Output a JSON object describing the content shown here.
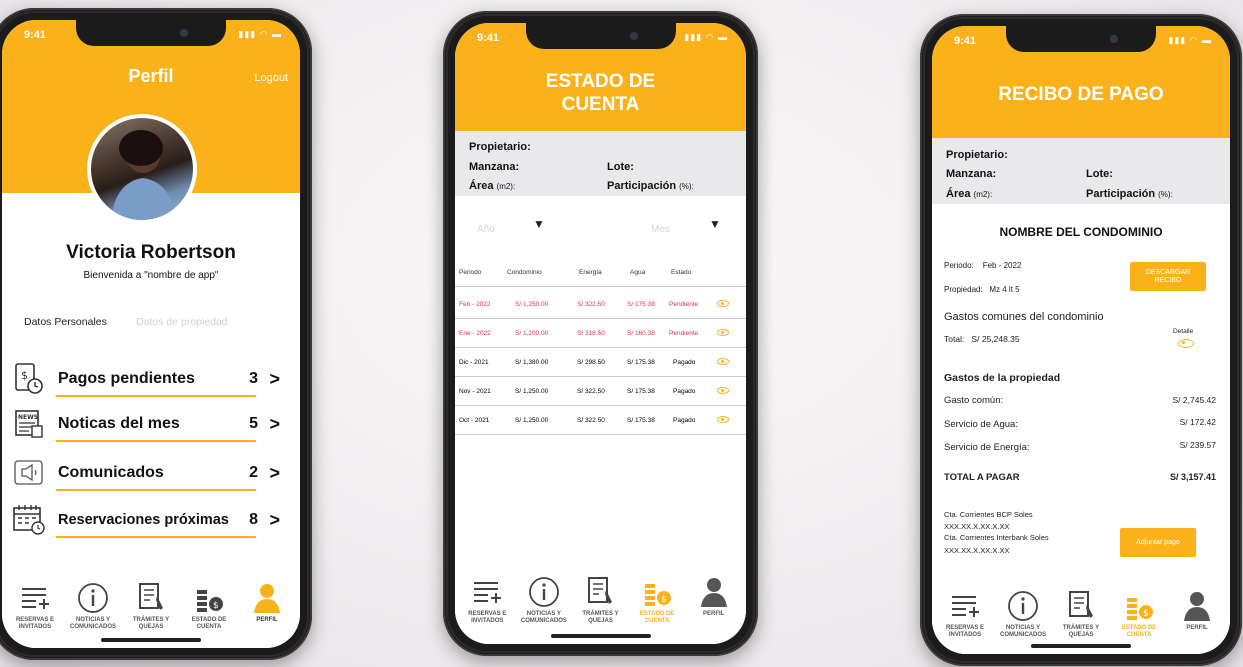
{
  "status": {
    "time": "9:41"
  },
  "perfil": {
    "title": "Perfil",
    "logout": "Logout",
    "name": "Victoria Robertson",
    "welcome": "Bienvenida a \"nombre de app\"",
    "tab_personal": "Datos Personales",
    "tab_property": "Datos de propiedad",
    "menu": [
      {
        "label": "Pagos pendientes",
        "count": "3",
        "icon": "receipt-icon"
      },
      {
        "label": "Noticas del mes",
        "count": "5",
        "icon": "news-icon"
      },
      {
        "label": "Comunicados",
        "count": "2",
        "icon": "megaphone-icon"
      },
      {
        "label": "Reservaciones próximas",
        "count": "8",
        "icon": "calendar-icon"
      }
    ]
  },
  "tabbar": {
    "reservas": "RESERVAS E INVITADOS",
    "noticias": "NOTICIAS Y COMUNICADOS",
    "tramites": "TRÁMITES Y QUEJAS",
    "estado": "ESTADO DE CUENTA",
    "perfil": "PERFIL"
  },
  "estado": {
    "title_line1": "ESTADO DE",
    "title_line2": "CUENTA",
    "propietario": "Propietario:",
    "manzana": "Manzana:",
    "lote": "Lote:",
    "area": "Área",
    "area_unit": "(m2):",
    "participacion": "Participación",
    "participacion_unit": "(%):",
    "year_placeholder": "Año",
    "month_placeholder": "Mes",
    "headers": [
      "Periodo",
      "Condominio",
      "Energía",
      "Agua",
      "Estado"
    ],
    "rows": [
      {
        "periodo": "Feb - 2022",
        "condominio": "S/ 1,250.00",
        "energia": "S/ 322.50",
        "agua": "S/ 175.38",
        "estado": "Pendiente",
        "pending": true
      },
      {
        "periodo": "Ene - 2022",
        "condominio": "S/ 1,200.00",
        "energia": "S/ 318.50",
        "agua": "S/ 160.38",
        "estado": "Pendiente",
        "pending": true
      },
      {
        "periodo": "Dic - 2021",
        "condominio": "S/ 1,380.00",
        "energia": "S/ 298.50",
        "agua": "S/ 175.38",
        "estado": "Pagado",
        "pending": false
      },
      {
        "periodo": "Nov - 2021",
        "condominio": "S/ 1,250.00",
        "energia": "S/ 322.50",
        "agua": "S/ 175.38",
        "estado": "Pagado",
        "pending": false
      },
      {
        "periodo": "Oct - 2021",
        "condominio": "S/ 1,250.00",
        "energia": "S/ 322.50",
        "agua": "S/ 175.38",
        "estado": "Pagado",
        "pending": false
      }
    ]
  },
  "recibo": {
    "title": "RECIBO DE PAGO",
    "propietario": "Propietario:",
    "manzana": "Manzana:",
    "lote": "Lote:",
    "area": "Área",
    "area_unit": "(m2):",
    "participacion": "Participación",
    "participacion_unit": "(%):",
    "condominio": "NOMBRE DEL CONDOMINIO",
    "periodo_label": "Periodo:",
    "periodo_value": "Feb - 2022",
    "propiedad_label": "Propiedad:",
    "propiedad_value": "Mz 4 lt 5",
    "descargar": "DESCARGAR RECIBO",
    "gastos_comunes": "Gastos comunes del condominio",
    "total_label": "Total:",
    "total_value": "S/ 25,248.35",
    "detalle": "Detalle",
    "gastos_propiedad": "Gastos de la propiedad",
    "items": [
      {
        "label": "Gasto común:",
        "value": "S/ 2,745.42"
      },
      {
        "label": "Servicio de Agua:",
        "value": "S/ 172.42"
      },
      {
        "label": "Servicio de Energía:",
        "value": "S/ 239.57"
      }
    ],
    "total_pagar_label": "TOTAL A PAGAR",
    "total_pagar_value": "S/ 3,157.41",
    "cta1_label": "Cta. Corrientes BCP Soles",
    "cta1_num": "XXX.XX.X.XX.X.XX",
    "cta2_label": "Cta. Corrientes Interbank Soles",
    "cta2_num": "XXX.XX.X.XX.X.XX",
    "adjuntar": "Adjuntar pago"
  },
  "colors": {
    "accent": "#fbb11a",
    "pending": "#e0314e"
  }
}
